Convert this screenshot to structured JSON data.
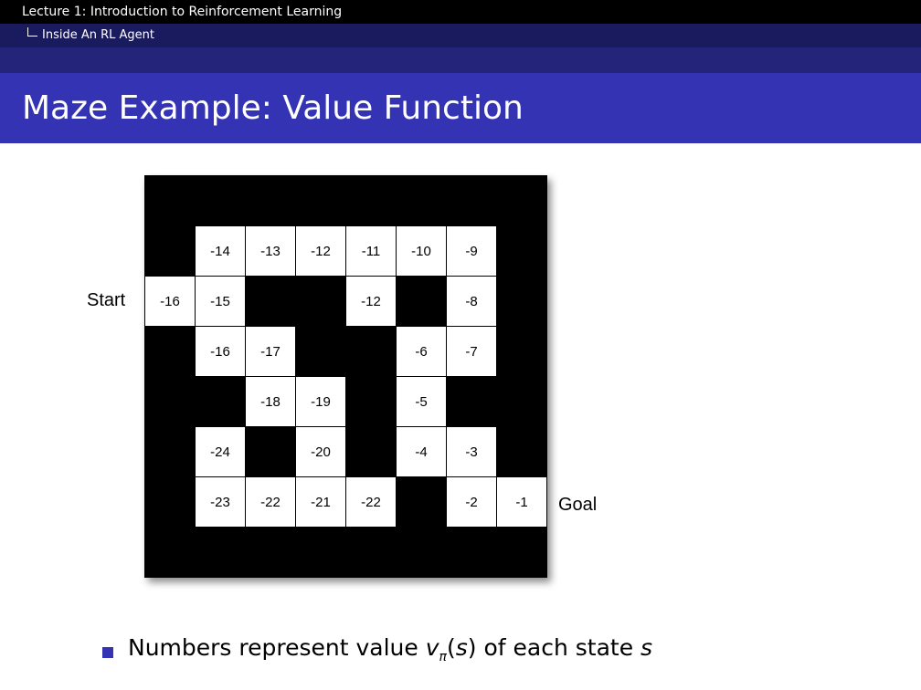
{
  "header": {
    "lecture": "Lecture 1: Introduction to Reinforcement Learning",
    "section": "Inside An RL Agent"
  },
  "slide": {
    "title": "Maze Example: Value Function"
  },
  "maze": {
    "start_label": "Start",
    "goal_label": "Goal",
    "cells": [
      {
        "row": 0,
        "col": 1,
        "value": "-14"
      },
      {
        "row": 0,
        "col": 2,
        "value": "-13"
      },
      {
        "row": 0,
        "col": 3,
        "value": "-12"
      },
      {
        "row": 0,
        "col": 4,
        "value": "-11"
      },
      {
        "row": 0,
        "col": 5,
        "value": "-10"
      },
      {
        "row": 0,
        "col": 6,
        "value": "-9"
      },
      {
        "row": 1,
        "col": 0,
        "value": "-16"
      },
      {
        "row": 1,
        "col": 1,
        "value": "-15"
      },
      {
        "row": 1,
        "col": 4,
        "value": "-12"
      },
      {
        "row": 1,
        "col": 6,
        "value": "-8"
      },
      {
        "row": 2,
        "col": 1,
        "value": "-16"
      },
      {
        "row": 2,
        "col": 2,
        "value": "-17"
      },
      {
        "row": 2,
        "col": 5,
        "value": "-6"
      },
      {
        "row": 2,
        "col": 6,
        "value": "-7"
      },
      {
        "row": 3,
        "col": 2,
        "value": "-18"
      },
      {
        "row": 3,
        "col": 3,
        "value": "-19"
      },
      {
        "row": 3,
        "col": 5,
        "value": "-5"
      },
      {
        "row": 4,
        "col": 1,
        "value": "-24"
      },
      {
        "row": 4,
        "col": 3,
        "value": "-20"
      },
      {
        "row": 4,
        "col": 5,
        "value": "-4"
      },
      {
        "row": 4,
        "col": 6,
        "value": "-3"
      },
      {
        "row": 5,
        "col": 1,
        "value": "-23"
      },
      {
        "row": 5,
        "col": 2,
        "value": "-22"
      },
      {
        "row": 5,
        "col": 3,
        "value": "-21"
      },
      {
        "row": 5,
        "col": 4,
        "value": "-22"
      },
      {
        "row": 5,
        "col": 6,
        "value": "-2"
      },
      {
        "row": 5,
        "col": 7,
        "value": "-1"
      }
    ]
  },
  "bullet": {
    "prefix": "Numbers represent value ",
    "v": "v",
    "pi": "π",
    "open": "(",
    "s_arg": "s",
    "close": ")",
    "middle": " of each state ",
    "s_end": "s"
  },
  "colors": {
    "header_black": "#000000",
    "header_navy": "#1a1a5e",
    "header_band": "#24247a",
    "title_blue": "#3333b3",
    "bullet_blue": "#3333b3"
  }
}
